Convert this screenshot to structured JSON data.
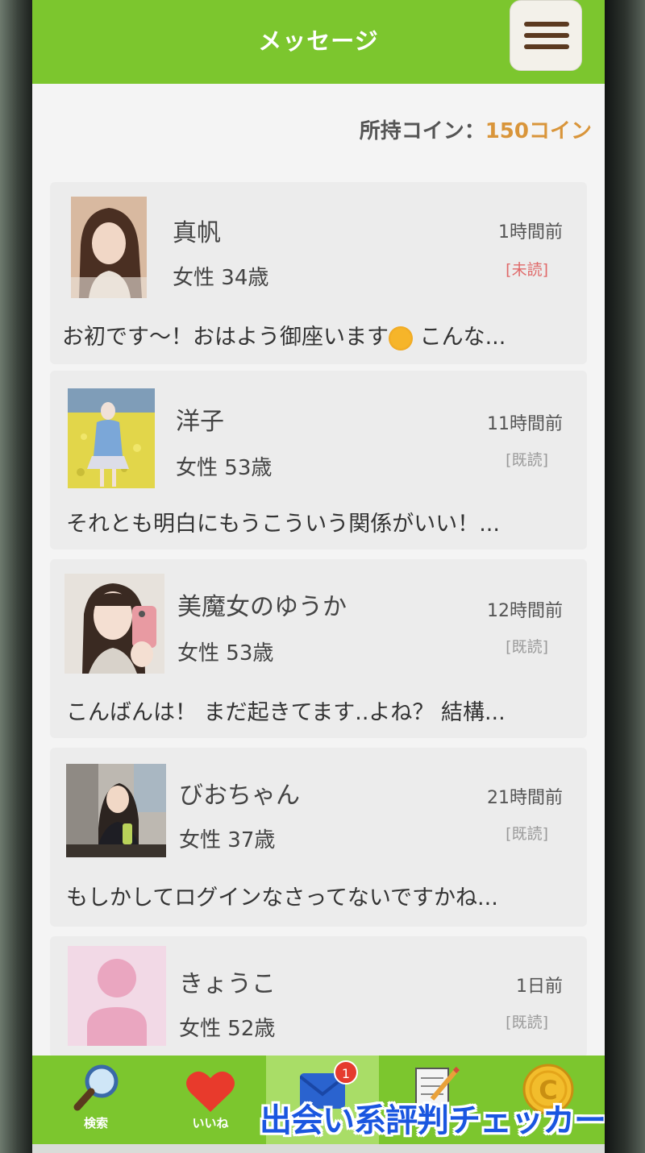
{
  "header": {
    "title": "メッセージ",
    "menu_icon": "hamburger-icon"
  },
  "coins": {
    "label": "所持コイン：",
    "amount": "150コイン"
  },
  "messages": [
    {
      "name": "真帆",
      "gender": "女性",
      "age": "34歳",
      "time": "1時間前",
      "status": "[未読]",
      "preview_before_emoji": "お初です～！おはよう御座います",
      "emoji": "sun-emoji",
      "preview_after_emoji": " こんな..."
    },
    {
      "name": "洋子",
      "gender": "女性",
      "age": "53歳",
      "time": "11時間前",
      "status": "[既読]",
      "preview": "それとも明白にもうこういう関係がいい！..."
    },
    {
      "name": "美魔女のゆうか",
      "gender": "女性",
      "age": "53歳",
      "time": "12時間前",
      "status": "[既読]",
      "preview": "こんばんは！ まだ起きてます..よね？ 結構..."
    },
    {
      "name": "びおちゃん",
      "gender": "女性",
      "age": "37歳",
      "time": "21時間前",
      "status": "[既読]",
      "preview": "もしかしてログインなさってないですかね..."
    },
    {
      "name": "きょうこ",
      "gender": "女性",
      "age": "52歳",
      "time": "1日前",
      "status": "[既読]",
      "preview": ""
    }
  ],
  "tabs": [
    {
      "label": "検索",
      "icon": "magnifier-icon"
    },
    {
      "label": "いいね",
      "icon": "heart-icon"
    },
    {
      "label": "",
      "icon": "envelope-icon",
      "badge": "1",
      "active": true
    },
    {
      "label": "",
      "icon": "notepad-icon"
    },
    {
      "label": "",
      "icon": "coin-icon",
      "coin_letter": "C"
    }
  ],
  "watermark": "出会い系評判チェッカー",
  "colors": {
    "header_green": "#7cc62e",
    "coin_orange": "#d9953a",
    "unread_red": "#e06a6a",
    "watermark_blue": "#1a56e0"
  }
}
